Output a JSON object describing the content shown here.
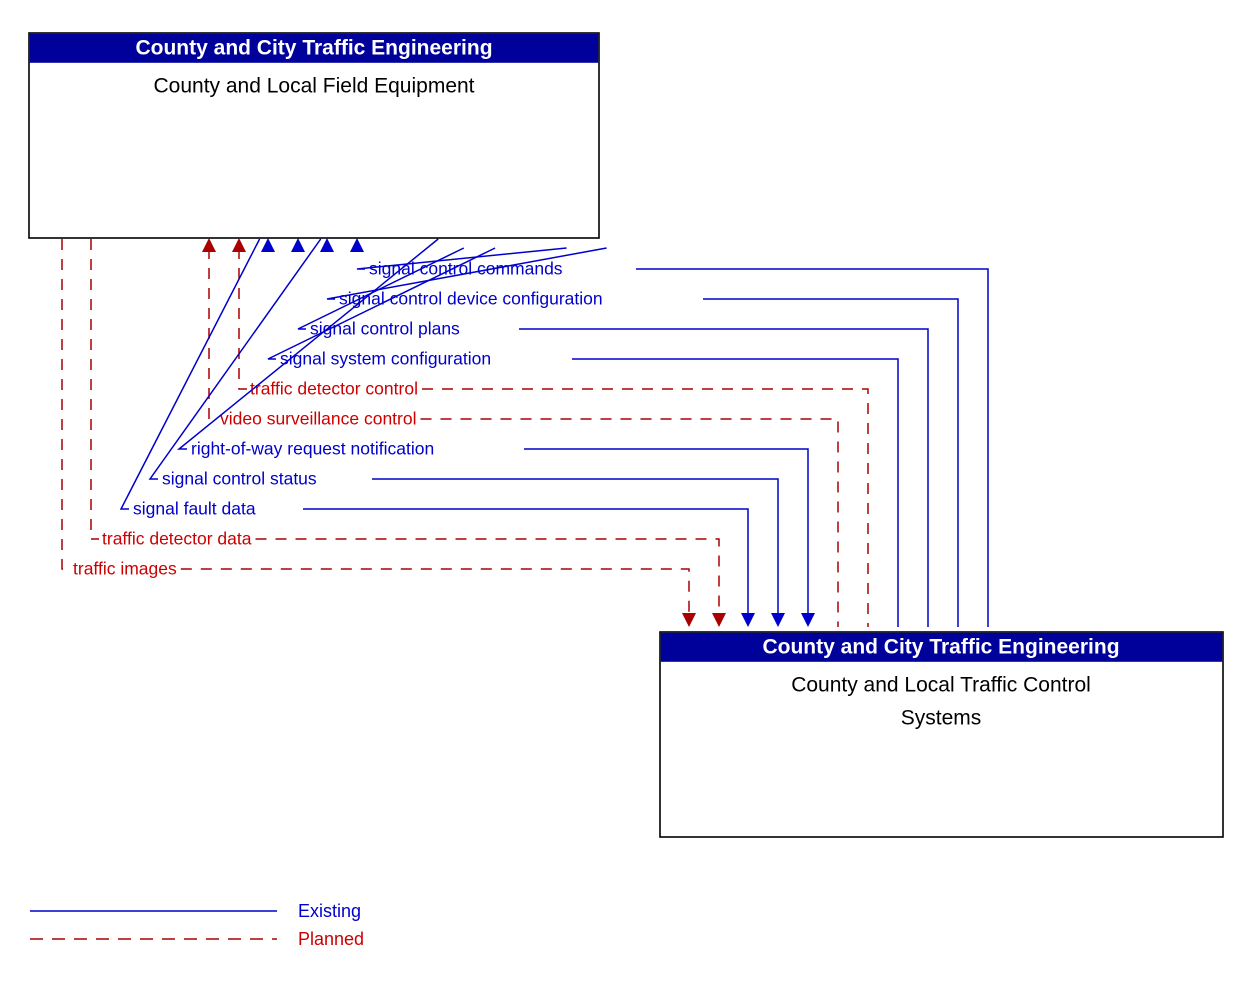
{
  "diagram": {
    "type": "interface-flow-diagram",
    "boxes": [
      {
        "id": "top-box",
        "stakeholder": "County and City Traffic Engineering",
        "name": "County and Local Field Equipment"
      },
      {
        "id": "bottom-box",
        "stakeholder": "County and City Traffic Engineering",
        "name": "County and Local Traffic Control Systems"
      }
    ],
    "flows": [
      {
        "label": "signal control commands",
        "status": "Existing",
        "direction": "bottom-to-top"
      },
      {
        "label": "signal control device configuration",
        "status": "Existing",
        "direction": "bottom-to-top"
      },
      {
        "label": "signal control plans",
        "status": "Existing",
        "direction": "bottom-to-top"
      },
      {
        "label": "signal system configuration",
        "status": "Existing",
        "direction": "bottom-to-top"
      },
      {
        "label": "traffic detector control",
        "status": "Planned",
        "direction": "bottom-to-top"
      },
      {
        "label": "video surveillance control",
        "status": "Planned",
        "direction": "bottom-to-top"
      },
      {
        "label": "right-of-way request notification",
        "status": "Existing",
        "direction": "top-to-bottom"
      },
      {
        "label": "signal control status",
        "status": "Existing",
        "direction": "top-to-bottom"
      },
      {
        "label": "signal fault data",
        "status": "Existing",
        "direction": "top-to-bottom"
      },
      {
        "label": "traffic detector data",
        "status": "Planned",
        "direction": "top-to-bottom"
      },
      {
        "label": "traffic images",
        "status": "Planned",
        "direction": "top-to-bottom"
      }
    ],
    "legend": {
      "items": [
        {
          "label": "Existing",
          "style": "solid",
          "color": "#0000CC"
        },
        {
          "label": "Planned",
          "style": "dashed",
          "color": "#CC0000"
        }
      ]
    },
    "colors": {
      "header_bg": "#00009B",
      "header_text": "#FFFFFF",
      "existing": "#0000CC",
      "planned": "#CC0000",
      "box_border": "#000000",
      "box_bg": "#FFFFFF"
    }
  }
}
